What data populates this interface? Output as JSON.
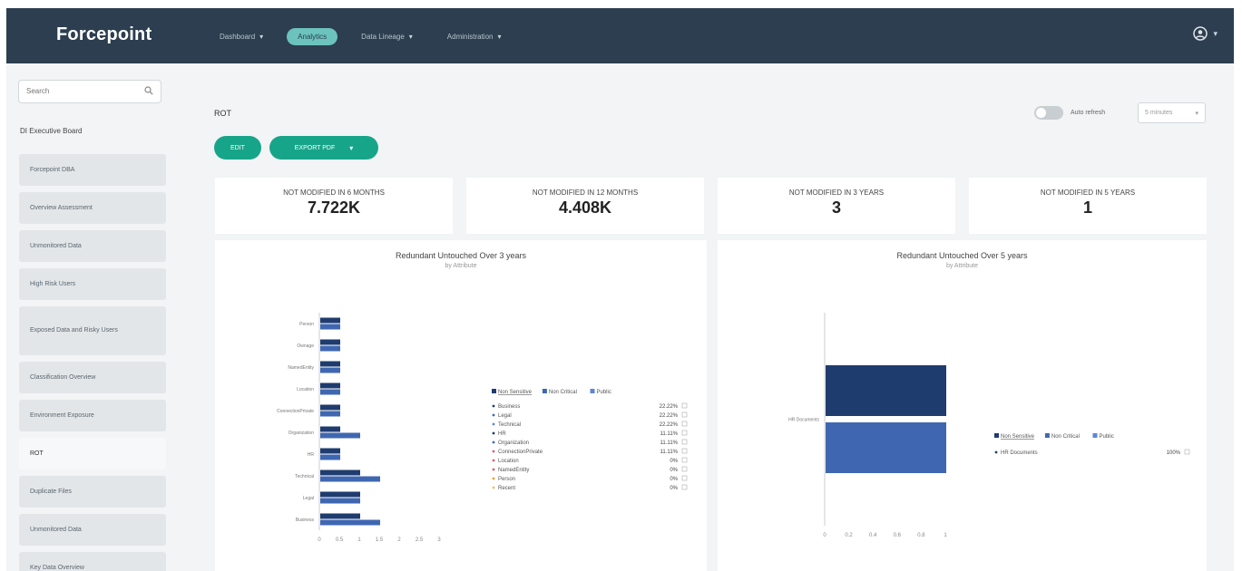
{
  "app": {
    "logo": "Forcepoint"
  },
  "nav": {
    "items": [
      {
        "label": "Dashboard",
        "caret": true,
        "active": false
      },
      {
        "label": "Analytics",
        "caret": false,
        "active": true
      },
      {
        "label": "Data Lineage",
        "caret": true,
        "active": false
      },
      {
        "label": "Administration",
        "caret": true,
        "active": false
      }
    ],
    "user_icon": "user-circle-icon"
  },
  "sidebar": {
    "search_placeholder": "Search",
    "section_title": "DI Executive Board",
    "items": [
      {
        "label": "Forcepoint DBA",
        "tall": false,
        "active": false
      },
      {
        "label": "Overview Assessment",
        "tall": false,
        "active": false
      },
      {
        "label": "Unmonitored Data",
        "tall": false,
        "active": false
      },
      {
        "label": "High Risk Users",
        "tall": false,
        "active": false
      },
      {
        "label": "Exposed Data and Risky Users",
        "tall": true,
        "active": false
      },
      {
        "label": "Classification Overview",
        "tall": false,
        "active": false
      },
      {
        "label": "Environment Exposure",
        "tall": false,
        "active": false
      },
      {
        "label": "ROT",
        "tall": false,
        "active": true
      },
      {
        "label": "Duplicate Files",
        "tall": false,
        "active": false
      },
      {
        "label": "Unmonitored Data",
        "tall": false,
        "active": false
      },
      {
        "label": "Key Data Overview",
        "tall": false,
        "active": false
      }
    ]
  },
  "page": {
    "title": "ROT",
    "edit_label": "EDIT",
    "export_label": "EXPORT PDF",
    "auto_refresh_label": "Auto refresh",
    "refresh_interval": "5 minutes"
  },
  "stats": [
    {
      "label": "NOT MODIFIED IN 6 MONTHS",
      "value": "7.722K"
    },
    {
      "label": "NOT MODIFIED IN 12 MONTHS",
      "value": "4.408K"
    },
    {
      "label": "NOT MODIFIED IN 3 YEARS",
      "value": "3"
    },
    {
      "label": "NOT MODIFIED IN 5 YEARS",
      "value": "1"
    }
  ],
  "colors": {
    "accent": "#17a589",
    "nav_bg": "#2c3e4f",
    "series_dark": "#1f3c6e",
    "series_mid": "#3f67b1",
    "series_light": "#5b87d6"
  },
  "chart_data": [
    {
      "type": "bar",
      "orientation": "horizontal",
      "title": "Redundant Untouched Over 3 years",
      "subtitle": "by Attribute",
      "categories": [
        "Person",
        "Ownage",
        "NamedEntity",
        "Location",
        "ConnectionPrivate",
        "Organization",
        "HR",
        "Technical",
        "Legal",
        "Business"
      ],
      "series": [
        {
          "name": "Non Sensitive",
          "values": [
            0.5,
            0.5,
            0.5,
            0.5,
            0.5,
            0.5,
            0.5,
            1,
            1,
            1
          ]
        },
        {
          "name": "Non Critical",
          "values": [
            0.5,
            0.5,
            0.5,
            0.5,
            0.5,
            1,
            0.5,
            1.5,
            1,
            1.5
          ]
        }
      ],
      "xticks": [
        "0",
        "0.5",
        "1",
        "1.5",
        "2",
        "2.5",
        "3"
      ],
      "xlim": [
        0,
        3
      ],
      "legend": [
        "Non Sensitive",
        "Non Critical",
        "Public"
      ],
      "table": [
        {
          "name": "Business",
          "pct": "22.22%",
          "color": "#1f3c6e"
        },
        {
          "name": "Legal",
          "pct": "22.22%",
          "color": "#3f67b1"
        },
        {
          "name": "Technical",
          "pct": "22.22%",
          "color": "#5b87d6"
        },
        {
          "name": "HR",
          "pct": "11.11%",
          "color": "#1f3c6e"
        },
        {
          "name": "Organization",
          "pct": "11.11%",
          "color": "#3f67b1"
        },
        {
          "name": "ConnectionPrivate",
          "pct": "11.11%",
          "color": "#e05c6e"
        },
        {
          "name": "Location",
          "pct": "0%",
          "color": "#e05c6e"
        },
        {
          "name": "NamedEntity",
          "pct": "0%",
          "color": "#e05c6e"
        },
        {
          "name": "Person",
          "pct": "0%",
          "color": "#f0a030"
        },
        {
          "name": "Recent",
          "pct": "0%",
          "color": "#f0c060"
        }
      ]
    },
    {
      "type": "bar",
      "orientation": "horizontal",
      "title": "Redundant Untouched Over 5 years",
      "subtitle": "by Attribute",
      "categories": [
        "HR Documents"
      ],
      "series": [
        {
          "name": "Non Sensitive",
          "values": [
            1
          ]
        },
        {
          "name": "Non Critical",
          "values": [
            1
          ]
        }
      ],
      "xticks": [
        "0",
        "0.2",
        "0.4",
        "0.6",
        "0.8",
        "1"
      ],
      "xlim": [
        0,
        1
      ],
      "legend": [
        "Non Sensitive",
        "Non Critical",
        "Public"
      ],
      "table": [
        {
          "name": "HR Documents",
          "pct": "100%",
          "color": "#1f3c6e"
        }
      ]
    }
  ]
}
